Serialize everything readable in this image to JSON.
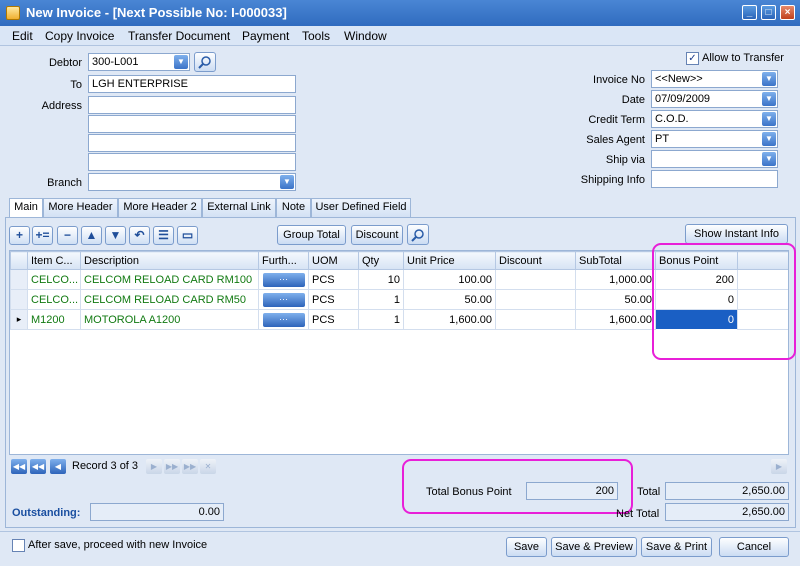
{
  "window": {
    "title": "New Invoice - [Next Possible No: I-000033]",
    "min": "_",
    "max": "□",
    "close": "×"
  },
  "menu": [
    "Edit",
    "Copy Invoice",
    "Transfer Document",
    "Payment",
    "Tools",
    "Window"
  ],
  "header": {
    "debtor_label": "Debtor",
    "debtor_value": "300-L001",
    "to_label": "To",
    "to_value": "LGH ENTERPRISE",
    "address_label": "Address",
    "address_lines": [
      "",
      "",
      "",
      ""
    ],
    "branch_label": "Branch",
    "branch_value": "",
    "allow_transfer_label": "Allow to Transfer",
    "allow_transfer_checked": true,
    "invoice_no_label": "Invoice No",
    "invoice_no_value": "<<New>>",
    "date_label": "Date",
    "date_value": "07/09/2009",
    "credit_term_label": "Credit Term",
    "credit_term_value": "C.O.D.",
    "sales_agent_label": "Sales Agent",
    "sales_agent_value": "PT",
    "ship_via_label": "Ship via",
    "ship_via_value": "",
    "shipping_info_label": "Shipping Info",
    "shipping_info_value": ""
  },
  "tabs": [
    "Main",
    "More Header",
    "More Header 2",
    "External Link",
    "Note",
    "User Defined Field"
  ],
  "toolbar": {
    "group_total": "Group Total",
    "discount": "Discount",
    "show_instant_info": "Show Instant Info"
  },
  "grid": {
    "columns": [
      "Item C...",
      "Description",
      "Furth...",
      "UOM",
      "Qty",
      "Unit Price",
      "Discount",
      "SubTotal",
      "Bonus Point"
    ],
    "rows": [
      {
        "item": "CELCO...",
        "desc": "CELCOM RELOAD CARD RM100",
        "further": "···",
        "uom": "PCS",
        "qty": "10",
        "unit_price": "100.00",
        "discount": "",
        "subtotal": "1,000.00",
        "bonus": "200"
      },
      {
        "item": "CELCO...",
        "desc": "CELCOM RELOAD CARD RM50",
        "further": "···",
        "uom": "PCS",
        "qty": "1",
        "unit_price": "50.00",
        "discount": "",
        "subtotal": "50.00",
        "bonus": "0"
      },
      {
        "item": "M1200",
        "desc": "MOTOROLA A1200",
        "further": "···",
        "uom": "PCS",
        "qty": "1",
        "unit_price": "1,600.00",
        "discount": "",
        "subtotal": "1,600.00",
        "bonus": "0"
      }
    ],
    "current_row_marker": "▸"
  },
  "nav": {
    "record_text": "Record 3 of 3"
  },
  "totals": {
    "total_bonus_label": "Total Bonus Point",
    "total_bonus_value": "200",
    "total_label": "Total",
    "total_value": "2,650.00",
    "net_total_label": "Net Total",
    "net_total_value": "2,650.00",
    "outstanding_label": "Outstanding:",
    "outstanding_value": "0.00"
  },
  "footer": {
    "proceed_label": "After save, proceed with new Invoice",
    "proceed_checked": false,
    "save": "Save",
    "save_preview": "Save & Preview",
    "save_print": "Save & Print",
    "cancel": "Cancel"
  },
  "colors": {
    "highlight": "#e81fd8",
    "accent": "#2f6bbf",
    "item_text": "#127a12"
  }
}
